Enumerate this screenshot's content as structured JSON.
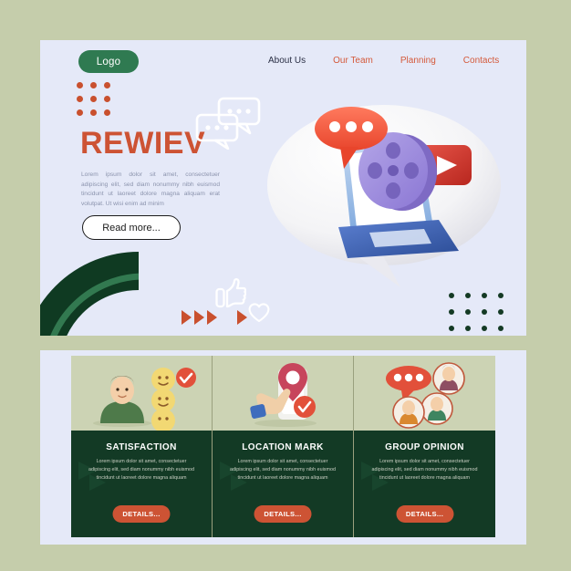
{
  "page": {
    "background_color": "#c5cdab",
    "panel_color": "#e5e9f8",
    "accent_orange": "#cd5334",
    "accent_green": "#2f7a51",
    "dark_green": "#133a25"
  },
  "hero": {
    "logo_label": "Logo",
    "nav": [
      {
        "label": "About Us",
        "color": "#2a2f45"
      },
      {
        "label": "Our Team",
        "color": "#cd5334"
      },
      {
        "label": "Planning",
        "color": "#cd5334"
      },
      {
        "label": "Contacts",
        "color": "#cd5334"
      }
    ],
    "headline": "REWIEV",
    "lead": "Lorem ipsum dolor sit amet, consectetuer adipiscing elit, sed diam nonummy nibh euismod tincidunt ut laoreet dolore magna aliquam erat volutpat. Ut wisi enim ad minim",
    "read_more_label": "Read more...",
    "decorations": {
      "dot_grid_orange": "3x3 orange dot grid",
      "dot_grid_green": "4x3 dark green dot grid",
      "arc": "green quarter arc",
      "triangles": "orange play triangles",
      "chat_bubbles_outline": "white outline chat bubbles",
      "thumbs_up_outline": "white outline thumbs up",
      "heart_outline": "white outline heart"
    },
    "illustration": {
      "name": "speech-bubble-laptop-video-review",
      "parts": [
        "white speech bubble",
        "blue laptop",
        "purple film reel",
        "red play button",
        "orange chat bubble"
      ]
    }
  },
  "cards": [
    {
      "title": "SATISFACTION",
      "text": "Lorem ipsum dolor sit amet, consectetuer adipiscing elit, sed diam nonummy nibh euismod tincidunt ut laoreet dolore magna aliquam",
      "button_label": "DETAILS...",
      "icon": "person-smiley-rating-icon"
    },
    {
      "title": "LOCATION MARK",
      "text": "Lorem ipsum dolor sit amet, consectetuer adipiscing elit, sed diam nonummy nibh euismod tincidunt ut laoreet dolore magna aliquam",
      "button_label": "DETAILS...",
      "icon": "hand-phone-location-pin-icon"
    },
    {
      "title": "GROUP OPINION",
      "text": "Lorem ipsum dolor sit amet, consectetuer adipiscing elit, sed diam nonummy nibh euismod tincidunt ut laoreet dolore magna aliquam",
      "button_label": "DETAILS...",
      "icon": "group-avatars-chat-icon"
    }
  ]
}
